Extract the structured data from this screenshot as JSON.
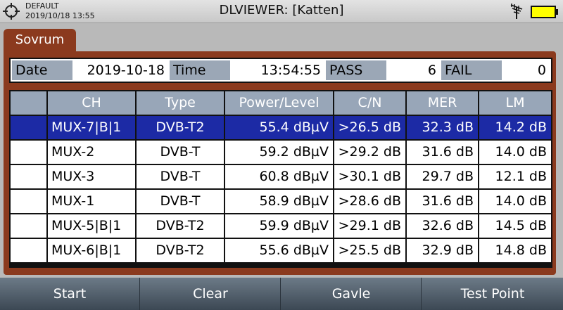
{
  "status_bar": {
    "profile": "DEFAULT",
    "datetime": "2019/10/18 13:55",
    "title": "DLVIEWER: [Katten]",
    "icons": [
      "target-icon",
      "antenna-icon",
      "battery-icon"
    ],
    "battery_color": "#ffff00"
  },
  "tab": {
    "label": "Sovrum"
  },
  "summary": {
    "date_label": "Date",
    "date_value": "2019-10-18",
    "time_label": "Time",
    "time_value": "13:54:55",
    "pass_label": "PASS",
    "pass_value": "6",
    "fail_label": "FAIL",
    "fail_value": "0"
  },
  "table": {
    "headers": [
      "",
      "CH",
      "Type",
      "Power/Level",
      "C/N",
      "MER",
      "LM"
    ],
    "rows": [
      {
        "ch": "MUX-7|B|1",
        "type": "DVB-T2",
        "power": "55.4 dBµV",
        "cn": ">26.5 dB",
        "mer": "32.3 dB",
        "lm": "14.2 dB",
        "selected": true
      },
      {
        "ch": "MUX-2",
        "type": "DVB-T",
        "power": "59.2 dBµV",
        "cn": ">29.2 dB",
        "mer": "31.6 dB",
        "lm": "14.0 dB",
        "selected": false
      },
      {
        "ch": "MUX-3",
        "type": "DVB-T",
        "power": "60.8 dBµV",
        "cn": ">30.1 dB",
        "mer": "29.7 dB",
        "lm": "12.1 dB",
        "selected": false
      },
      {
        "ch": "MUX-1",
        "type": "DVB-T",
        "power": "58.9 dBµV",
        "cn": ">28.6 dB",
        "mer": "31.6 dB",
        "lm": "14.0 dB",
        "selected": false
      },
      {
        "ch": "MUX-5|B|1",
        "type": "DVB-T2",
        "power": "59.9 dBµV",
        "cn": ">29.1 dB",
        "mer": "32.6 dB",
        "lm": "14.5 dB",
        "selected": false
      },
      {
        "ch": "MUX-6|B|1",
        "type": "DVB-T2",
        "power": "55.6 dBµV",
        "cn": ">25.5 dB",
        "mer": "32.9 dB",
        "lm": "14.8 dB",
        "selected": false
      }
    ]
  },
  "softkeys": [
    "Start",
    "Clear",
    "Gavle",
    "Test Point"
  ],
  "colors": {
    "panel": "#8b3a1e",
    "header": "#98a6b8",
    "selected_row": "#1c2aa5"
  }
}
